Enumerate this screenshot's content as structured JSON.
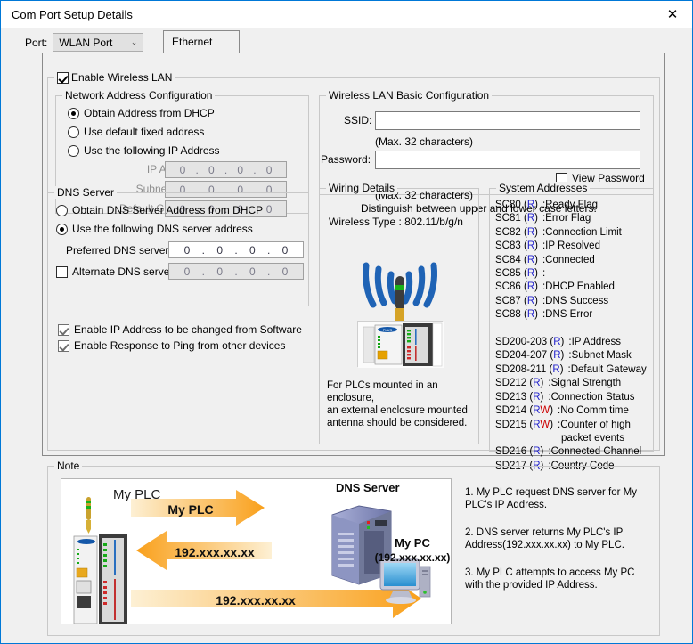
{
  "window": {
    "title": "Com Port Setup Details",
    "close_icon": "close-icon"
  },
  "port": {
    "label": "Port:",
    "value": "WLAN Port",
    "caret": "⌄"
  },
  "tabs": [
    {
      "label": "Ethernet",
      "selected": true
    }
  ],
  "enable_wireless": {
    "label": "Enable Wireless LAN",
    "checked": true
  },
  "network_address": {
    "legend": "Network Address Configuration",
    "options": [
      {
        "label": "Obtain Address from DHCP",
        "selected": true
      },
      {
        "label": "Use default fixed address",
        "selected": false
      },
      {
        "label": "Use the following IP Address",
        "selected": false
      }
    ],
    "fields": [
      {
        "label": "IP Address:",
        "value": [
          "0",
          "0",
          "0",
          "0"
        ],
        "disabled": true
      },
      {
        "label": "Subnet Mask:",
        "value": [
          "0",
          "0",
          "0",
          "0"
        ],
        "disabled": true
      },
      {
        "label": "Default Gateway:",
        "value": [
          "0",
          "0",
          "0",
          "0"
        ],
        "disabled": true
      }
    ]
  },
  "dns_server": {
    "legend": "DNS Server",
    "options": [
      {
        "label": "Obtain DNS Server Address from DHCP",
        "selected": false
      },
      {
        "label": "Use the following DNS server address",
        "selected": true
      }
    ],
    "preferred": {
      "label": "Preferred DNS server:",
      "value": [
        "0",
        "0",
        "0",
        "0"
      ],
      "disabled": false
    },
    "alternate": {
      "label": "Alternate DNS server:",
      "value": [
        "0",
        "0",
        "0",
        "0"
      ],
      "checked": false,
      "disabled": true
    }
  },
  "extra_options": [
    {
      "label": "Enable IP Address to be changed from Software",
      "checked": true
    },
    {
      "label": "Enable Response to Ping from other devices",
      "checked": true
    }
  ],
  "wlan_basic": {
    "legend": "Wireless LAN Basic Configuration",
    "ssid_label": "SSID:",
    "ssid_value": "",
    "ssid_placeholder": "",
    "ssid_hint": "(Max. 32 characters)",
    "password_label": "Password:",
    "password_value": "",
    "password_placeholder": "",
    "password_hint": "(Max. 32 characters)",
    "case_note": "Distinguish between upper and lower case letters.",
    "view_password_label": "View Password",
    "view_password_checked": false
  },
  "wiring": {
    "legend": "Wiring Details",
    "wireless_type": "Wireless Type : 802.11/b/g/n",
    "note_line1": "For PLCs mounted in an enclosure,",
    "note_line2": "an external enclosure mounted",
    "note_line3": "antenna should be considered.",
    "antenna_icon": "wifi-antenna-icon",
    "plc_icon": "plc-device-icon"
  },
  "system_addresses": {
    "legend": "System Addresses",
    "entries": [
      {
        "addr": "SC80",
        "access": "R",
        "desc": ":Ready Flag"
      },
      {
        "addr": "SC81",
        "access": "R",
        "desc": ":Error Flag"
      },
      {
        "addr": "SC82",
        "access": "R",
        "desc": ":Connection Limit"
      },
      {
        "addr": "SC83",
        "access": "R",
        "desc": ":IP Resolved"
      },
      {
        "addr": "SC84",
        "access": "R",
        "desc": ":Connected"
      },
      {
        "addr": "SC85",
        "access": "R",
        "desc": ":"
      },
      {
        "addr": "SC86",
        "access": "R",
        "desc": ":DHCP Enabled"
      },
      {
        "addr": "SC87",
        "access": "R",
        "desc": ":DNS Success"
      },
      {
        "addr": "SC88",
        "access": "R",
        "desc": ":DNS Error"
      },
      {
        "addr": "",
        "access": "",
        "desc": ""
      },
      {
        "addr": "SD200-203",
        "access": "R",
        "desc": ":IP Address"
      },
      {
        "addr": "SD204-207",
        "access": "R",
        "desc": ":Subnet Mask"
      },
      {
        "addr": "SD208-211",
        "access": "R",
        "desc": ":Default Gateway"
      },
      {
        "addr": "SD212",
        "access": "R",
        "desc": ":Signal Strength"
      },
      {
        "addr": "SD213",
        "access": "R",
        "desc": ":Connection Status"
      },
      {
        "addr": "SD214",
        "access": "RW",
        "desc": ":No Comm time"
      },
      {
        "addr": "SD215",
        "access": "RW",
        "desc": ":Counter of high"
      },
      {
        "addr": "",
        "access": "",
        "desc": "packet events"
      },
      {
        "addr": "SD216",
        "access": "R",
        "desc": ":Connected Channel"
      },
      {
        "addr": "SD217",
        "access": "R",
        "desc": ":Country Code"
      }
    ]
  },
  "note": {
    "legend": "Note",
    "diagram": {
      "plc_label": "My PLC",
      "dns_label": "DNS Server",
      "pc_label": "My PC",
      "pc_ip": "(192.xxx.xx.xx)",
      "arrow1_label": "My PLC",
      "arrow2_label": "192.xxx.xx.xx",
      "arrow3_label": "192.xxx.xx.xx"
    },
    "steps": [
      "1. My PLC request DNS server for My PLC's IP Address.",
      "2. DNS server returns My PLC's IP Address(192.xxx.xx.xx) to My PLC.",
      "3. My PLC attempts to access My PC with the provided IP Address."
    ]
  },
  "colors": {
    "accent": "#0078d7",
    "read_flag": "#2222cc",
    "write_flag": "#cc0000",
    "arrow_orange": "#f9a01b",
    "panel_bg": "#f0f0f0"
  }
}
